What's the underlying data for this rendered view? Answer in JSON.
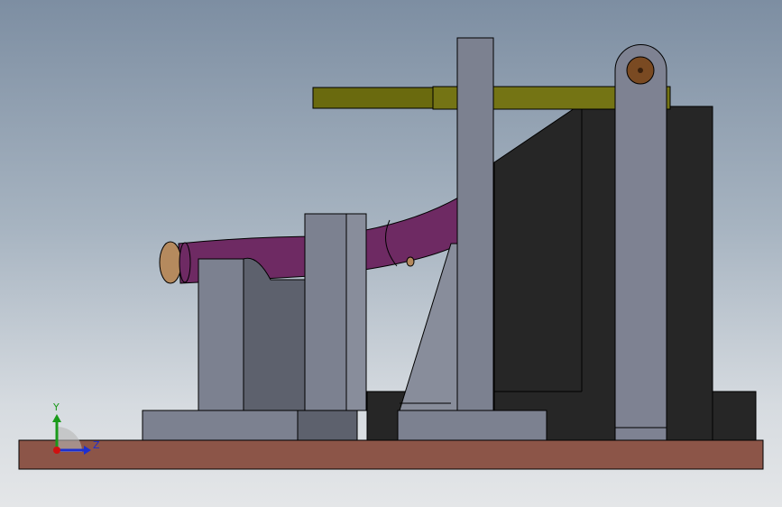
{
  "viewport": {
    "background_top": "#7d8ea2",
    "background_bottom": "#e4e6e8"
  },
  "triad": {
    "y_label": "Y",
    "z_label": "Z",
    "y_color": "#1a9a1a",
    "z_color": "#1d2fd0",
    "x_color": "#d01010"
  },
  "colors": {
    "base_plate": "#8c5548",
    "grey_part": "#7c8190",
    "grey_shadow": "#5d616d",
    "dark_block": "#262626",
    "purple_tube": "#6e2a63",
    "olive_rod": "#6e6e10",
    "wood_end": "#b58a5e",
    "pin": "#7a4a22"
  }
}
